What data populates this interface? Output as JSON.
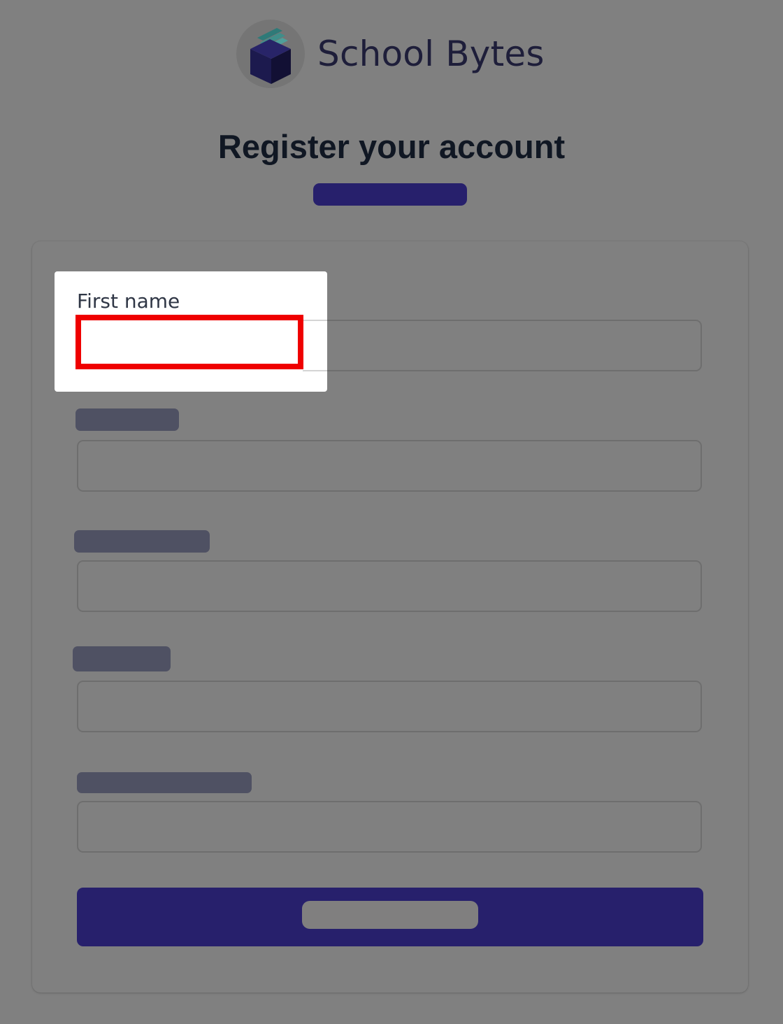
{
  "brand": {
    "name": "School Bytes",
    "logo_icon": "book-shield-icon",
    "colors": {
      "book_front": "#1c1a4e",
      "book_side": "#121034",
      "pages": [
        "#2f7a78",
        "#3f8e8a",
        "#4f9f9a"
      ]
    }
  },
  "page": {
    "title": "Register your account"
  },
  "form": {
    "first_name": {
      "label": "First name",
      "value": "",
      "highlighted": true
    },
    "hidden_fields": 4
  },
  "colors": {
    "accent": "#27206c",
    "highlight": "#ef0000",
    "overlay": "#808080"
  }
}
